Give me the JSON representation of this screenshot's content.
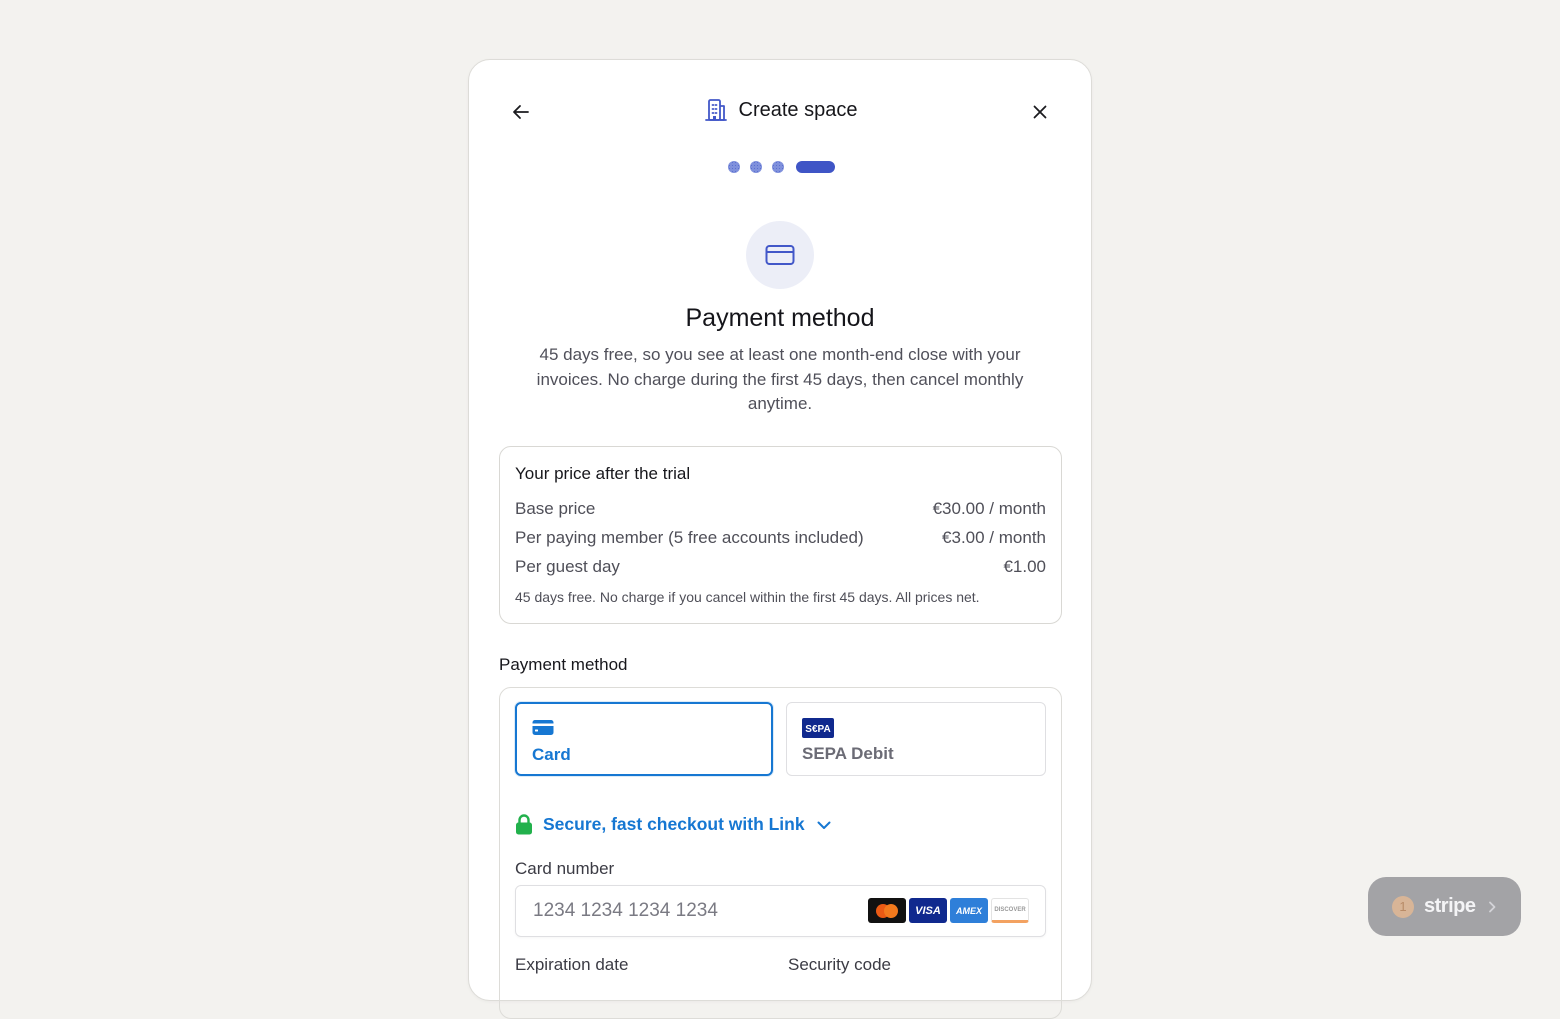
{
  "header": {
    "title": "Create space"
  },
  "steps": {
    "current": 4,
    "total": 4
  },
  "page": {
    "title": "Payment method",
    "subtitle": "45 days free, so you see at least one month-end close with your invoices. No charge during the first 45 days, then cancel monthly anytime."
  },
  "pricing": {
    "heading": "Your price after the trial",
    "rows": [
      {
        "label": "Base price",
        "value": "€30.00 / month"
      },
      {
        "label": "Per paying member (5 free accounts included)",
        "value": "€3.00 / month"
      },
      {
        "label": "Per guest day",
        "value": "€1.00"
      }
    ],
    "note": "45 days free. No charge if you cancel within the first 45 days. All prices net."
  },
  "payment": {
    "label": "Payment method",
    "tabs": [
      {
        "label": "Card",
        "icon": "credit-card-icon",
        "selected": true
      },
      {
        "label": "SEPA Debit",
        "icon": "sepa-icon",
        "selected": false
      }
    ],
    "link_text": "Secure, fast checkout with Link",
    "card_number_label": "Card number",
    "card_number_placeholder": "1234 1234 1234 1234",
    "card_brands": [
      "mastercard",
      "VISA",
      "AMEX",
      "DISCOVER"
    ],
    "expiration_label": "Expiration date",
    "security_label": "Security code"
  },
  "stripe_badge": {
    "count": "1",
    "label": "stripe"
  },
  "colors": {
    "accent": "#3f55c6",
    "stripe_blue": "#1677d2",
    "link_green": "#22b14c",
    "background": "#f3f2ef"
  }
}
